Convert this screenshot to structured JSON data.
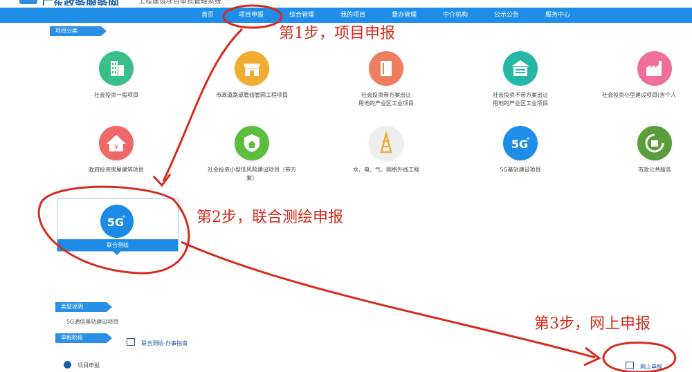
{
  "header": {
    "site_name": "广东政务服务网",
    "site_sub": "工程建设项目审批管理系统"
  },
  "nav": {
    "items": [
      "首页",
      "项目申报",
      "综合管理",
      "我的项目",
      "督办管理",
      "中介机构",
      "公示公告",
      "服务中心"
    ]
  },
  "section": {
    "category_ribbon": "项目分类",
    "type_ribbon": "类型说明",
    "stage_ribbon": "申报阶段"
  },
  "categories": [
    {
      "label": "社会投资一般项目",
      "color": "#39c08a",
      "icon": "building-icon"
    },
    {
      "label": "市政道路或管线管网工程项目",
      "color": "#f0ad2f",
      "icon": "shop-icon"
    },
    {
      "label": "社会投资带方案出让\n用地的产业区工业项目",
      "color": "#ef7e60",
      "icon": "book-icon"
    },
    {
      "label": "社会投资不带方案出让\n用地的产业区工业项目",
      "color": "#25b7a6",
      "icon": "warehouse-icon"
    },
    {
      "label": "社会投资小型建设项目(含个人",
      "color": "#f06f9a",
      "icon": "factory-icon"
    },
    {
      "label": "政府投资房屋建筑项目",
      "color": "#ef6868",
      "icon": "house-yuan-icon"
    },
    {
      "label": "社会投资小型低风险建设项目（带方\n案）",
      "color": "#5dbd3e",
      "icon": "shield-house-icon"
    },
    {
      "label": "水、电、气、网络外线工程",
      "color": "#eeeeee",
      "icon": "tower-icon"
    },
    {
      "label": "5G基站建设项目",
      "color": "#1f8ee8",
      "icon": "5g-icon"
    },
    {
      "label": "市政公共服务",
      "color": "#5a9e3c",
      "icon": "recycle-icon"
    }
  ],
  "selected": {
    "label": "联合测绘",
    "icon_text": "5G"
  },
  "type_note": "5G通信基站建设项目",
  "guide_link": "联合测绘-办事指南",
  "apply_label": "项目申报",
  "online_label": "网上申报",
  "annotations": {
    "step1": "第1步，项目申报",
    "step2": "第2步，联合测绘申报",
    "step3": "第3步，网上申报"
  },
  "colors": {
    "nav": "#1e8ee8",
    "accent": "#2a8fe6",
    "annotation": "#d9291c"
  }
}
